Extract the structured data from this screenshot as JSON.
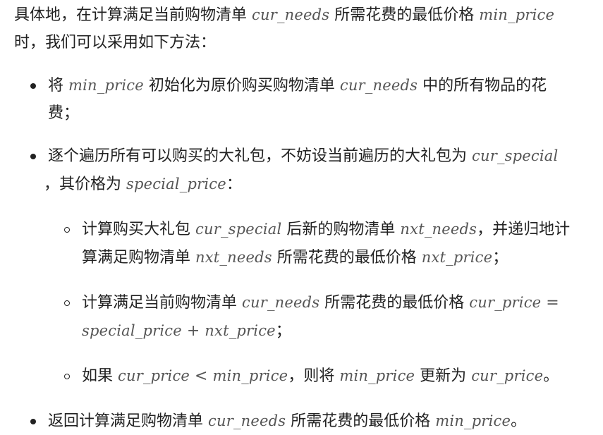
{
  "intro": {
    "l1_a": "具体地，在计算满足当前购物清单",
    "l1_m1": "cur_needs",
    "l1_b": "所需花费的最低价格",
    "l1_m2": "min_price",
    "l2": "时，我们可以采用如下方法："
  },
  "b1": {
    "a": "将",
    "m1": "min_price",
    "b": "初始化为原价购买购物清单",
    "m2": "cur_needs",
    "c": "中的所有物品的花",
    "l2": "费；"
  },
  "b2": {
    "a": "逐个遍历所有可以购买的大礼包，不妨设当前遍历的大礼包为",
    "m1": "cur_special",
    "l2_a": "，其价格为",
    "l2_m": "special_price",
    "l2_b": "："
  },
  "s1": {
    "a": "计算购买大礼包",
    "m1": "cur_special",
    "b": "后新的购物清单",
    "m2": "nxt_needs",
    "c": "，并递归地计",
    "l2_a": "算满足购物清单",
    "l2_m1": "nxt_needs",
    "l2_b": "所需花费的最低价格",
    "l2_m2": "nxt_price",
    "l2_c": "；"
  },
  "s2": {
    "a": "计算满足当前购物清单",
    "m1": "cur_needs",
    "b": "所需花费的最低价格",
    "m2": "cur_price",
    "op1": "=",
    "l2_m1": "special_price",
    "op2": "+",
    "l2_m2": "nxt_price",
    "l2_c": "；"
  },
  "s3": {
    "a": "如果",
    "m1": "cur_price",
    "op": "<",
    "m2": "min_price",
    "b": "，则将",
    "m3": "min_price",
    "c": "更新为",
    "m4": "cur_price",
    "d": "。"
  },
  "b3": {
    "a": "返回计算满足购物清单",
    "m1": "cur_needs",
    "b": "所需花费的最低价格",
    "m2": "min_price",
    "c": "。"
  }
}
